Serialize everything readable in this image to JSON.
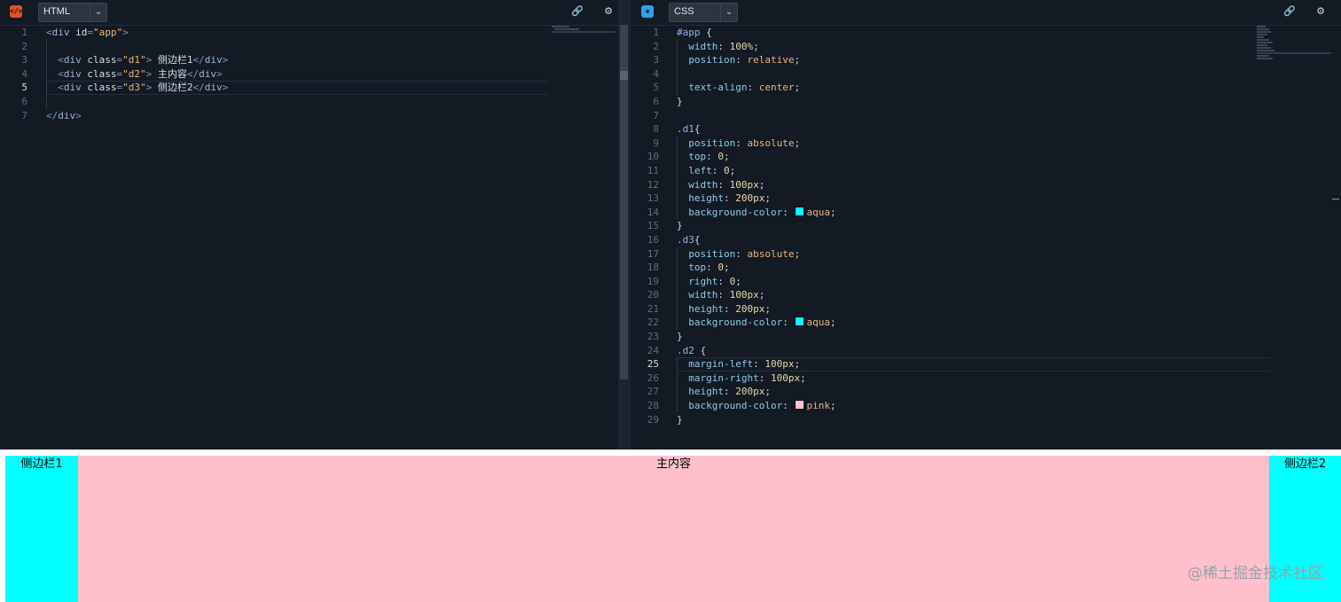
{
  "html_editor": {
    "language": "HTML",
    "icon": "html-icon",
    "lines": [
      {
        "n": "1",
        "parts": [
          [
            "tg",
            "<"
          ],
          [
            "tn",
            "div"
          ],
          [
            "an",
            " id"
          ],
          [
            "tg",
            "="
          ],
          [
            "av",
            "\"app\""
          ],
          [
            "tg",
            ">"
          ]
        ]
      },
      {
        "n": "2",
        "parts": []
      },
      {
        "n": "3",
        "parts": [
          [
            "pun",
            "  "
          ],
          [
            "tg",
            "<"
          ],
          [
            "tn",
            "div"
          ],
          [
            "an",
            " class"
          ],
          [
            "tg",
            "="
          ],
          [
            "av",
            "\"d1\""
          ],
          [
            "tg",
            ">"
          ],
          [
            "ct",
            " 侧边栏1"
          ],
          [
            "tg",
            "</"
          ],
          [
            "tn",
            "div"
          ],
          [
            "tg",
            ">"
          ]
        ]
      },
      {
        "n": "4",
        "parts": [
          [
            "pun",
            "  "
          ],
          [
            "tg",
            "<"
          ],
          [
            "tn",
            "div"
          ],
          [
            "an",
            " class"
          ],
          [
            "tg",
            "="
          ],
          [
            "av",
            "\"d2\""
          ],
          [
            "tg",
            ">"
          ],
          [
            "ct",
            " 主内容"
          ],
          [
            "tg",
            "</"
          ],
          [
            "tn",
            "div"
          ],
          [
            "tg",
            ">"
          ]
        ]
      },
      {
        "n": "5",
        "parts": [
          [
            "pun",
            "  "
          ],
          [
            "tg",
            "<"
          ],
          [
            "tn",
            "div"
          ],
          [
            "an",
            " class"
          ],
          [
            "tg",
            "="
          ],
          [
            "av",
            "\"d3\""
          ],
          [
            "tg",
            ">"
          ],
          [
            "ct",
            " 侧边栏2"
          ],
          [
            "tg",
            "</"
          ],
          [
            "tn",
            "div"
          ],
          [
            "tg",
            ">"
          ]
        ],
        "active": true
      },
      {
        "n": "6",
        "parts": []
      },
      {
        "n": "7",
        "parts": [
          [
            "tg",
            "</"
          ],
          [
            "tn",
            "div"
          ],
          [
            "tg",
            ">"
          ]
        ]
      }
    ]
  },
  "css_editor": {
    "language": "CSS",
    "icon": "css-icon",
    "lines": [
      {
        "n": "1",
        "parts": [
          [
            "sel",
            "#app"
          ],
          [
            "pun",
            " {"
          ]
        ]
      },
      {
        "n": "2",
        "parts": [
          [
            "pun",
            "  "
          ],
          [
            "pr",
            "width"
          ],
          [
            "pun",
            ": "
          ],
          [
            "num",
            "100%"
          ],
          [
            "pun",
            ";"
          ]
        ]
      },
      {
        "n": "3",
        "parts": [
          [
            "pun",
            "  "
          ],
          [
            "pr",
            "position"
          ],
          [
            "pun",
            ": "
          ],
          [
            "vl",
            "relative"
          ],
          [
            "pun",
            ";"
          ]
        ]
      },
      {
        "n": "4",
        "parts": []
      },
      {
        "n": "5",
        "parts": [
          [
            "pun",
            "  "
          ],
          [
            "pr",
            "text-align"
          ],
          [
            "pun",
            ": "
          ],
          [
            "vl",
            "center"
          ],
          [
            "pun",
            ";"
          ]
        ]
      },
      {
        "n": "6",
        "parts": [
          [
            "pun",
            "}"
          ]
        ]
      },
      {
        "n": "7",
        "parts": []
      },
      {
        "n": "8",
        "parts": [
          [
            "sel",
            ".d1"
          ],
          [
            "pun",
            "{"
          ]
        ]
      },
      {
        "n": "9",
        "parts": [
          [
            "pun",
            "  "
          ],
          [
            "pr",
            "position"
          ],
          [
            "pun",
            ": "
          ],
          [
            "vl",
            "absolute"
          ],
          [
            "pun",
            ";"
          ]
        ]
      },
      {
        "n": "10",
        "parts": [
          [
            "pun",
            "  "
          ],
          [
            "pr",
            "top"
          ],
          [
            "pun",
            ": "
          ],
          [
            "num",
            "0"
          ],
          [
            "pun",
            ";"
          ]
        ]
      },
      {
        "n": "11",
        "parts": [
          [
            "pun",
            "  "
          ],
          [
            "pr",
            "left"
          ],
          [
            "pun",
            ": "
          ],
          [
            "num",
            "0"
          ],
          [
            "pun",
            ";"
          ]
        ]
      },
      {
        "n": "12",
        "parts": [
          [
            "pun",
            "  "
          ],
          [
            "pr",
            "width"
          ],
          [
            "pun",
            ": "
          ],
          [
            "num",
            "100px"
          ],
          [
            "pun",
            ";"
          ]
        ]
      },
      {
        "n": "13",
        "parts": [
          [
            "pun",
            "  "
          ],
          [
            "pr",
            "height"
          ],
          [
            "pun",
            ": "
          ],
          [
            "num",
            "200px"
          ],
          [
            "pun",
            ";"
          ]
        ]
      },
      {
        "n": "14",
        "parts": [
          [
            "pun",
            "  "
          ],
          [
            "pr",
            "background-color"
          ],
          [
            "pun",
            ": "
          ],
          [
            "swatch",
            "#00ffff"
          ],
          [
            "vl",
            "aqua"
          ],
          [
            "pun",
            ";"
          ]
        ]
      },
      {
        "n": "15",
        "parts": [
          [
            "pun",
            "}"
          ]
        ]
      },
      {
        "n": "16",
        "parts": [
          [
            "sel",
            ".d3"
          ],
          [
            "pun",
            "{"
          ]
        ]
      },
      {
        "n": "17",
        "parts": [
          [
            "pun",
            "  "
          ],
          [
            "pr",
            "position"
          ],
          [
            "pun",
            ": "
          ],
          [
            "vl",
            "absolute"
          ],
          [
            "pun",
            ";"
          ]
        ]
      },
      {
        "n": "18",
        "parts": [
          [
            "pun",
            "  "
          ],
          [
            "pr",
            "top"
          ],
          [
            "pun",
            ": "
          ],
          [
            "num",
            "0"
          ],
          [
            "pun",
            ";"
          ]
        ]
      },
      {
        "n": "19",
        "parts": [
          [
            "pun",
            "  "
          ],
          [
            "pr",
            "right"
          ],
          [
            "pun",
            ": "
          ],
          [
            "num",
            "0"
          ],
          [
            "pun",
            ";"
          ]
        ]
      },
      {
        "n": "20",
        "parts": [
          [
            "pun",
            "  "
          ],
          [
            "pr",
            "width"
          ],
          [
            "pun",
            ": "
          ],
          [
            "num",
            "100px"
          ],
          [
            "pun",
            ";"
          ]
        ]
      },
      {
        "n": "21",
        "parts": [
          [
            "pun",
            "  "
          ],
          [
            "pr",
            "height"
          ],
          [
            "pun",
            ": "
          ],
          [
            "num",
            "200px"
          ],
          [
            "pun",
            ";"
          ]
        ]
      },
      {
        "n": "22",
        "parts": [
          [
            "pun",
            "  "
          ],
          [
            "pr",
            "background-color"
          ],
          [
            "pun",
            ": "
          ],
          [
            "swatch",
            "#00ffff"
          ],
          [
            "vl",
            "aqua"
          ],
          [
            "pun",
            ";"
          ]
        ]
      },
      {
        "n": "23",
        "parts": [
          [
            "pun",
            "}"
          ]
        ]
      },
      {
        "n": "24",
        "parts": [
          [
            "sel",
            ".d2"
          ],
          [
            "pun",
            " {"
          ]
        ]
      },
      {
        "n": "25",
        "parts": [
          [
            "pun",
            "  "
          ],
          [
            "pr",
            "margin-left"
          ],
          [
            "pun",
            ": "
          ],
          [
            "num",
            "100px"
          ],
          [
            "pun",
            ";"
          ]
        ],
        "active": true
      },
      {
        "n": "26",
        "parts": [
          [
            "pun",
            "  "
          ],
          [
            "pr",
            "margin-right"
          ],
          [
            "pun",
            ": "
          ],
          [
            "num",
            "100px"
          ],
          [
            "pun",
            ";"
          ]
        ]
      },
      {
        "n": "27",
        "parts": [
          [
            "pun",
            "  "
          ],
          [
            "pr",
            "height"
          ],
          [
            "pun",
            ": "
          ],
          [
            "num",
            "200px"
          ],
          [
            "pun",
            ";"
          ]
        ]
      },
      {
        "n": "28",
        "parts": [
          [
            "pun",
            "  "
          ],
          [
            "pr",
            "background-color"
          ],
          [
            "pun",
            ": "
          ],
          [
            "swatch",
            "#ffc0cb"
          ],
          [
            "vl",
            "pink"
          ],
          [
            "pun",
            ";"
          ]
        ]
      },
      {
        "n": "29",
        "parts": [
          [
            "pun",
            "}"
          ]
        ]
      }
    ]
  },
  "toolbar": {
    "link_icon": "link-icon",
    "settings_icon": "gear-icon",
    "caret_icon": "chevron-down-icon"
  },
  "preview": {
    "sidebar1": "侧边栏1",
    "main": "主内容",
    "sidebar2": "侧边栏2",
    "watermark": "@稀土掘金技术社区",
    "colors": {
      "aqua": "#00ffff",
      "pink": "#ffc0cb"
    }
  }
}
